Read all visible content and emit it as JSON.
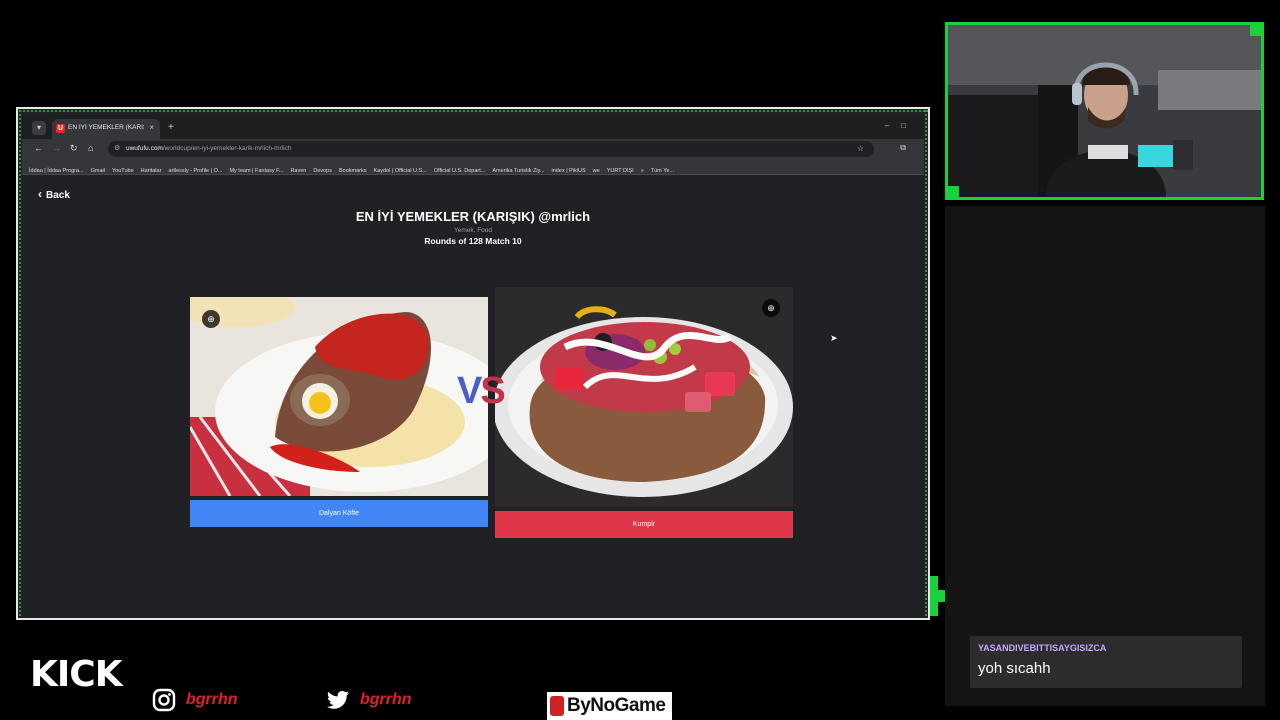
{
  "browser": {
    "tab_title": "EN İYİ YEMEKLER (KARIŞIK) @...",
    "tab_favicon": "U",
    "tab_close": "×",
    "new_tab": "+",
    "url_host": "uwufufu.com",
    "url_path": "/worldcup/en-iyi-yemekler-karik-mrlich-mrlich",
    "bookmarks": [
      "İddaa | İddaa Progra...",
      "Gmail",
      "YouTube",
      "Haritalar",
      "artlessly - Profile | O...",
      "My team | Fantasy F...",
      "Raven",
      "Devops",
      "Bookmarks",
      "Kaydol | Official U.S...",
      "Official U.S. Depart...",
      "Amerika Turistik Ziy...",
      "index | PikiUS",
      "we",
      "YURT DIŞI",
      "»",
      "Tüm Ye..."
    ]
  },
  "page": {
    "back_label": "Back",
    "title": "EN İYİ YEMEKLER (KARIŞIK) @mrlich",
    "tags": "Yemek, Food",
    "round_info": "Rounds of 128 Match 10",
    "vs_v": "V",
    "vs_s": "S",
    "left_choice": {
      "label": "Dalyan Köfte",
      "color": "#4285f4"
    },
    "right_choice": {
      "label": "Kumpir",
      "color": "#e0364a"
    }
  },
  "chat": {
    "username": "YASANDIVEBITTISAYGISIZCA",
    "message": "yoh sıcahh"
  },
  "overlay": {
    "platform": "KICK",
    "instagram_handle": "bgrrhn",
    "twitter_handle": "bgrrhn",
    "sponsor": "ByNoGame",
    "accent_color": "#19d13a"
  }
}
